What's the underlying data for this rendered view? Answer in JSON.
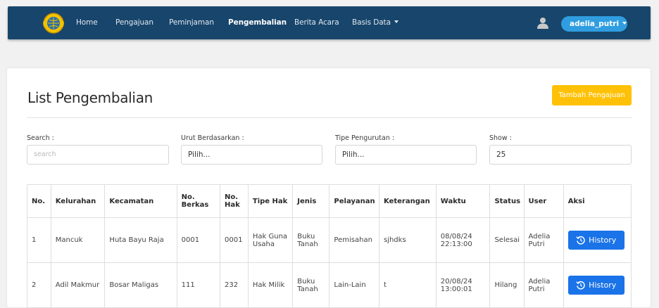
{
  "nav": {
    "items": [
      {
        "label": "Home"
      },
      {
        "label": "Pengajuan"
      },
      {
        "label": "Peminjaman"
      },
      {
        "label": "Pengembalian"
      },
      {
        "label": "Berita Acara"
      },
      {
        "label": "Basis Data"
      }
    ],
    "user": "adelia_putri",
    "colors": {
      "bar": "#18456b",
      "user_pill": "#2f9de0"
    }
  },
  "page": {
    "title": "List Pengembalian",
    "add_button": "Tambah Pengajuan"
  },
  "filters": {
    "search": {
      "label": "Search :",
      "placeholder": "search",
      "value": ""
    },
    "sort_by": {
      "label": "Urut Berdasarkan :",
      "value": "Pilih..."
    },
    "sort_type": {
      "label": "Tipe Pengurutan :",
      "value": "Pilih..."
    },
    "show": {
      "label": "Show :",
      "value": "25"
    }
  },
  "table": {
    "headers": [
      "No.",
      "Kelurahan",
      "Kecamatan",
      "No. Berkas",
      "No. Hak",
      "Tipe Hak",
      "Jenis",
      "Pelayanan",
      "Keterangan",
      "Waktu",
      "Status",
      "User",
      "Aksi"
    ],
    "rows": [
      {
        "no": "1",
        "kelurahan": "Mancuk",
        "kecamatan": "Huta Bayu Raja",
        "no_berkas": "0001",
        "no_hak": "0001",
        "tipe_hak": "Hak Guna Usaha",
        "jenis": "Buku Tanah",
        "pelayanan": "Pemisahan",
        "keterangan": "sjhdks",
        "waktu": "08/08/24 22:13:00",
        "status": "Selesai",
        "user": "Adelia Putri",
        "aksi": "History"
      },
      {
        "no": "2",
        "kelurahan": "Adil Makmur",
        "kecamatan": "Bosar Maligas",
        "no_berkas": "111",
        "no_hak": "232",
        "tipe_hak": "Hak Milik",
        "jenis": "Buku Tanah",
        "pelayanan": "Lain-Lain",
        "keterangan": "t",
        "waktu": "20/08/24 13:00:01",
        "status": "Hilang",
        "user": "Adelia Putri",
        "aksi": "History"
      }
    ]
  },
  "icons": [
    "logo-emblem",
    "user-icon",
    "history-icon",
    "caret-down-icon"
  ],
  "colors": {
    "accent_yellow": "#ffc107",
    "history_button": "#1a73e8"
  }
}
